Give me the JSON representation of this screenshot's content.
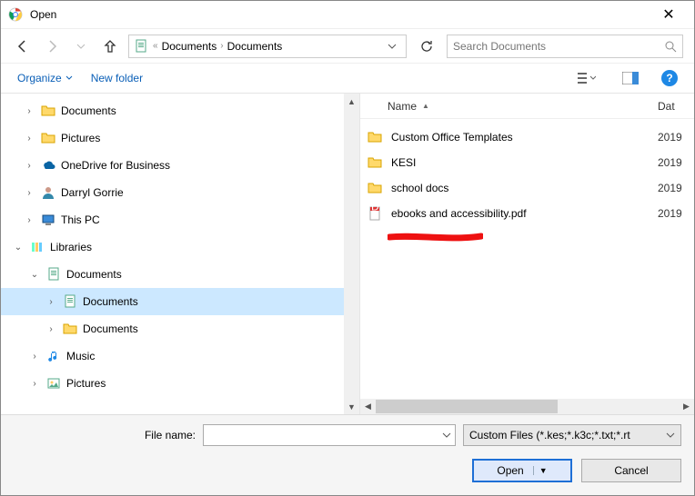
{
  "window": {
    "title": "Open"
  },
  "breadcrumb": {
    "parts": [
      "Documents",
      "Documents"
    ]
  },
  "search": {
    "placeholder": "Search Documents"
  },
  "toolbar": {
    "organize": "Organize",
    "newfolder": "New folder"
  },
  "tree": [
    {
      "indent": 24,
      "twist": ">",
      "icon": "folder",
      "label": "Documents"
    },
    {
      "indent": 24,
      "twist": ">",
      "icon": "folder",
      "label": "Pictures"
    },
    {
      "indent": 24,
      "twist": ">",
      "icon": "onedrive",
      "label": "OneDrive for Business"
    },
    {
      "indent": 24,
      "twist": ">",
      "icon": "user",
      "label": "Darryl Gorrie"
    },
    {
      "indent": 24,
      "twist": ">",
      "icon": "pc",
      "label": "This PC"
    },
    {
      "indent": 12,
      "twist": "v",
      "icon": "libraries",
      "label": "Libraries"
    },
    {
      "indent": 30,
      "twist": "v",
      "icon": "doclib",
      "label": "Documents"
    },
    {
      "indent": 48,
      "twist": ">",
      "icon": "doclib",
      "label": "Documents",
      "selected": true
    },
    {
      "indent": 48,
      "twist": ">",
      "icon": "folder",
      "label": "Documents"
    },
    {
      "indent": 30,
      "twist": ">",
      "icon": "music",
      "label": "Music"
    },
    {
      "indent": 30,
      "twist": ">",
      "icon": "pictures",
      "label": "Pictures"
    }
  ],
  "list": {
    "header_name": "Name",
    "header_date": "Dat",
    "rows": [
      {
        "icon": "folder",
        "name": "Custom Office Templates",
        "date": "2019"
      },
      {
        "icon": "folder",
        "name": "KESI",
        "date": "2019"
      },
      {
        "icon": "folder",
        "name": "school docs",
        "date": "2019"
      },
      {
        "icon": "pdf",
        "name": "ebooks and accessibility.pdf",
        "date": "2019"
      }
    ]
  },
  "bottom": {
    "filename_label": "File name:",
    "filter_text": "Custom Files (*.kes;*.k3c;*.txt;*.rt",
    "open": "Open",
    "cancel": "Cancel"
  }
}
